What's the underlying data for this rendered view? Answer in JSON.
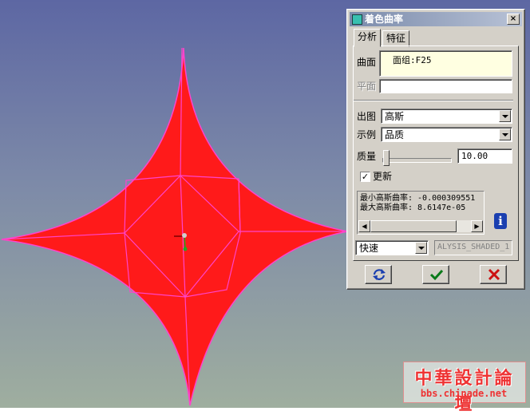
{
  "dialog": {
    "title": "着色曲率",
    "close_label": "×",
    "tabs": [
      {
        "label": "分析",
        "active": true
      },
      {
        "label": "特征",
        "active": false
      }
    ],
    "surface": {
      "label": "曲面",
      "value": "面组:F25"
    },
    "plane": {
      "label": "平面",
      "value": ""
    },
    "output": {
      "label": "出图",
      "value": "高斯"
    },
    "display": {
      "label": "示例",
      "value": "品质"
    },
    "quality": {
      "label": "质量",
      "value": "10.00",
      "slider_fraction": 0.0
    },
    "update": {
      "label": "更新",
      "checked": true
    },
    "results": {
      "min_line": "最小高斯曲率: -0.000309551",
      "max_line": "最大高斯曲率: 8.6147e-05"
    },
    "mode": {
      "value": "快速"
    },
    "name_field": {
      "value": "ALYSIS_SHADED_1"
    },
    "buttons": {
      "repeat": "repeat-icon",
      "ok": "checkmark-icon",
      "cancel": "close-x-icon"
    },
    "info_icon": "info-icon"
  },
  "watermark": {
    "title": "中華設計論壇",
    "url": "bbs.chinade.net"
  },
  "colors": {
    "surface_fill": "#ff1a1a",
    "mesh_lines": "#ff44cc",
    "dialog_bg": "#d4d0c8",
    "title_bar": "#8595b2"
  }
}
